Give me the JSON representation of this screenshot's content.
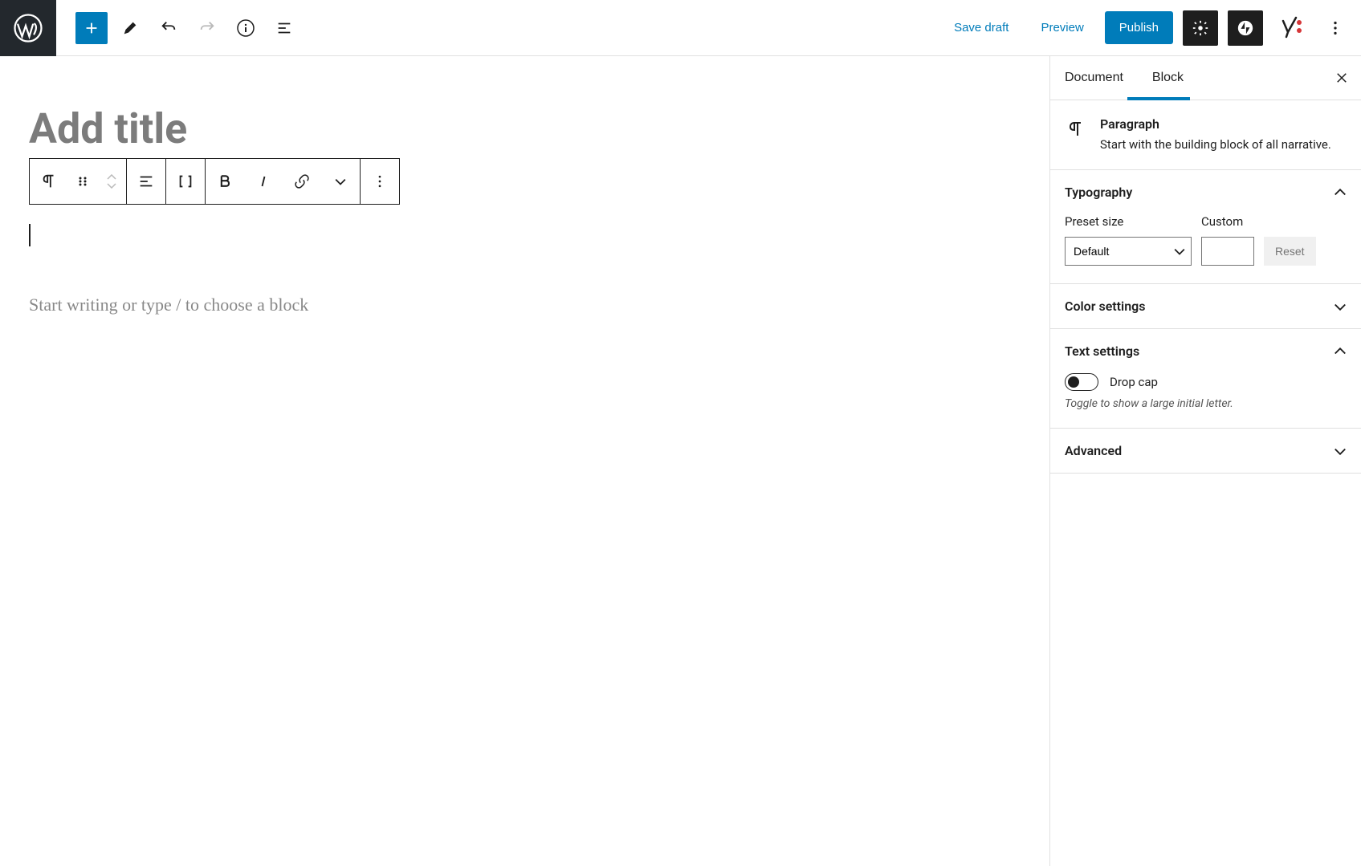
{
  "toolbar": {
    "save_draft": "Save draft",
    "preview": "Preview",
    "publish": "Publish"
  },
  "editor": {
    "title_placeholder": "Add title",
    "paragraph_placeholder": "Start writing or type / to choose a block"
  },
  "sidebar": {
    "tabs": {
      "document": "Document",
      "block": "Block"
    },
    "block_info": {
      "title": "Paragraph",
      "description": "Start with the building block of all narrative."
    },
    "typography": {
      "title": "Typography",
      "preset_label": "Preset size",
      "preset_value": "Default",
      "custom_label": "Custom",
      "custom_value": "",
      "reset": "Reset"
    },
    "color": {
      "title": "Color settings"
    },
    "text": {
      "title": "Text settings",
      "dropcap_label": "Drop cap",
      "dropcap_help": "Toggle to show a large initial letter."
    },
    "advanced": {
      "title": "Advanced"
    }
  }
}
